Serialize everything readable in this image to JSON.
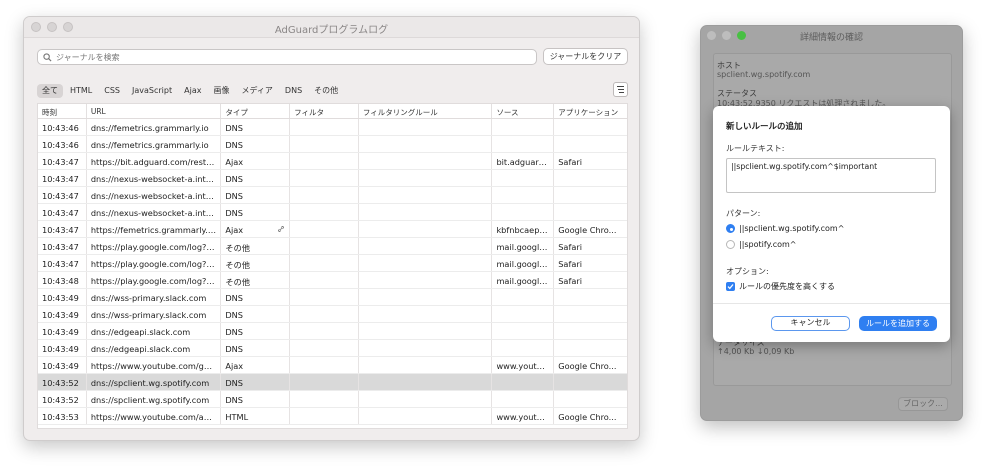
{
  "main_window": {
    "title": "AdGuardプログラムログ",
    "search_placeholder": "ジャーナルを検索",
    "clear_button": "ジャーナルをクリア",
    "filters": [
      "全て",
      "HTML",
      "CSS",
      "JavaScript",
      "Ajax",
      "画像",
      "メディア",
      "DNS",
      "その他"
    ],
    "active_filter": "全て",
    "columns": [
      "時刻",
      "URL",
      "タイプ",
      "フィルタ",
      "フィルタリングルール",
      "ソース",
      "アプリケーション"
    ],
    "rows": [
      {
        "time": "10:43:46",
        "url": "dns://femetrics.grammarly.io",
        "type": "DNS",
        "filter": "",
        "rule": "",
        "source": "",
        "app": ""
      },
      {
        "time": "10:43:46",
        "url": "dns://femetrics.grammarly.io",
        "type": "DNS",
        "filter": "",
        "rule": "",
        "source": "",
        "app": ""
      },
      {
        "time": "10:43:47",
        "url": "https://bit.adguard.com/rest/ui...",
        "type": "Ajax",
        "filter": "",
        "rule": "",
        "source": "bit.adguard....",
        "app": "Safari"
      },
      {
        "time": "10:43:47",
        "url": "dns://nexus-websocket-a.inter...",
        "type": "DNS",
        "filter": "",
        "rule": "",
        "source": "",
        "app": ""
      },
      {
        "time": "10:43:47",
        "url": "dns://nexus-websocket-a.inter...",
        "type": "DNS",
        "filter": "",
        "rule": "",
        "source": "",
        "app": ""
      },
      {
        "time": "10:43:47",
        "url": "dns://nexus-websocket-a.inter...",
        "type": "DNS",
        "filter": "",
        "rule": "",
        "source": "",
        "app": ""
      },
      {
        "time": "10:43:47",
        "url": "https://femetrics.grammarly.io...",
        "type": "Ajax",
        "filter": "",
        "rule": "",
        "source": "kbfnbcaepl...",
        "app": "Google Chro...",
        "link": true
      },
      {
        "time": "10:43:47",
        "url": "https://play.google.com/log?fo...",
        "type": "その他",
        "filter": "",
        "rule": "",
        "source": "mail.google....",
        "app": "Safari"
      },
      {
        "time": "10:43:47",
        "url": "https://play.google.com/log?fo...",
        "type": "その他",
        "filter": "",
        "rule": "",
        "source": "mail.google....",
        "app": "Safari"
      },
      {
        "time": "10:43:48",
        "url": "https://play.google.com/log?fo...",
        "type": "その他",
        "filter": "",
        "rule": "",
        "source": "mail.google....",
        "app": "Safari"
      },
      {
        "time": "10:43:49",
        "url": "dns://wss-primary.slack.com",
        "type": "DNS",
        "filter": "",
        "rule": "",
        "source": "",
        "app": ""
      },
      {
        "time": "10:43:49",
        "url": "dns://wss-primary.slack.com",
        "type": "DNS",
        "filter": "",
        "rule": "",
        "source": "",
        "app": ""
      },
      {
        "time": "10:43:49",
        "url": "dns://edgeapi.slack.com",
        "type": "DNS",
        "filter": "",
        "rule": "",
        "source": "",
        "app": ""
      },
      {
        "time": "10:43:49",
        "url": "dns://edgeapi.slack.com",
        "type": "DNS",
        "filter": "",
        "rule": "",
        "source": "",
        "app": ""
      },
      {
        "time": "10:43:49",
        "url": "https://www.youtube.com/gen...",
        "type": "Ajax",
        "filter": "",
        "rule": "",
        "source": "www.youtub...",
        "app": "Google Chro..."
      },
      {
        "time": "10:43:52",
        "url": "dns://spclient.wg.spotify.com",
        "type": "DNS",
        "filter": "",
        "rule": "",
        "source": "",
        "app": "",
        "selected": true
      },
      {
        "time": "10:43:52",
        "url": "dns://spclient.wg.spotify.com",
        "type": "DNS",
        "filter": "",
        "rule": "",
        "source": "",
        "app": ""
      },
      {
        "time": "10:43:53",
        "url": "https://www.youtube.com/api/...",
        "type": "HTML",
        "filter": "",
        "rule": "",
        "source": "www.youtub...",
        "app": "Google Chro..."
      }
    ]
  },
  "detail_window": {
    "title": "詳細情報の確認",
    "host_label": "ホスト",
    "host_value": "spclient.wg.spotify.com",
    "status_label": "ステータス",
    "status_value": "10:43:52.9350 リクエストは処理されました。",
    "size_label": "データサイズ",
    "size_value": "↑4,00 Kb ↓0,09 Kb",
    "block_button": "ブロック..."
  },
  "sheet": {
    "title": "新しいルールの追加",
    "rule_text_label": "ルールテキスト:",
    "rule_text": "||spclient.wg.spotify.com^$important",
    "pattern_label": "パターン:",
    "patterns": [
      {
        "label": "||spclient.wg.spotify.com^",
        "selected": true
      },
      {
        "label": "||spotify.com^",
        "selected": false
      }
    ],
    "options_label": "オプション:",
    "option_important": "ルールの優先度を高くする",
    "option_important_checked": true,
    "cancel_button": "キャンセル",
    "add_button": "ルールを追加する"
  },
  "colors": {
    "accent": "#2f7ff1",
    "selected_row": "#d9d9d9",
    "traffic_green": "#48c043"
  }
}
